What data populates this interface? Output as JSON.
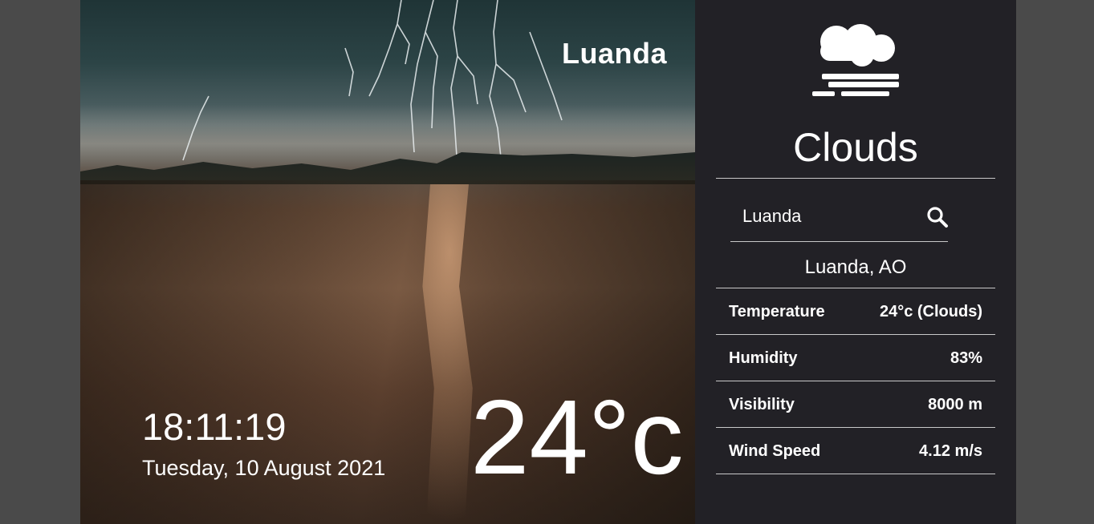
{
  "hero": {
    "city_title": "Luanda",
    "clock": "18:11:19",
    "date": "Tuesday,  10 August 2021",
    "big_temperature": "24°c"
  },
  "panel": {
    "icon": "cloud-fog-icon",
    "condition": "Clouds",
    "search": {
      "value": "Luanda",
      "icon": "search-icon"
    },
    "location": "Luanda, AO",
    "details": [
      {
        "label": "Temperature",
        "value": "24°c (Clouds)"
      },
      {
        "label": "Humidity",
        "value": "83%"
      },
      {
        "label": "Visibility",
        "value": "8000 m"
      },
      {
        "label": "Wind Speed",
        "value": "4.12 m/s"
      }
    ]
  }
}
